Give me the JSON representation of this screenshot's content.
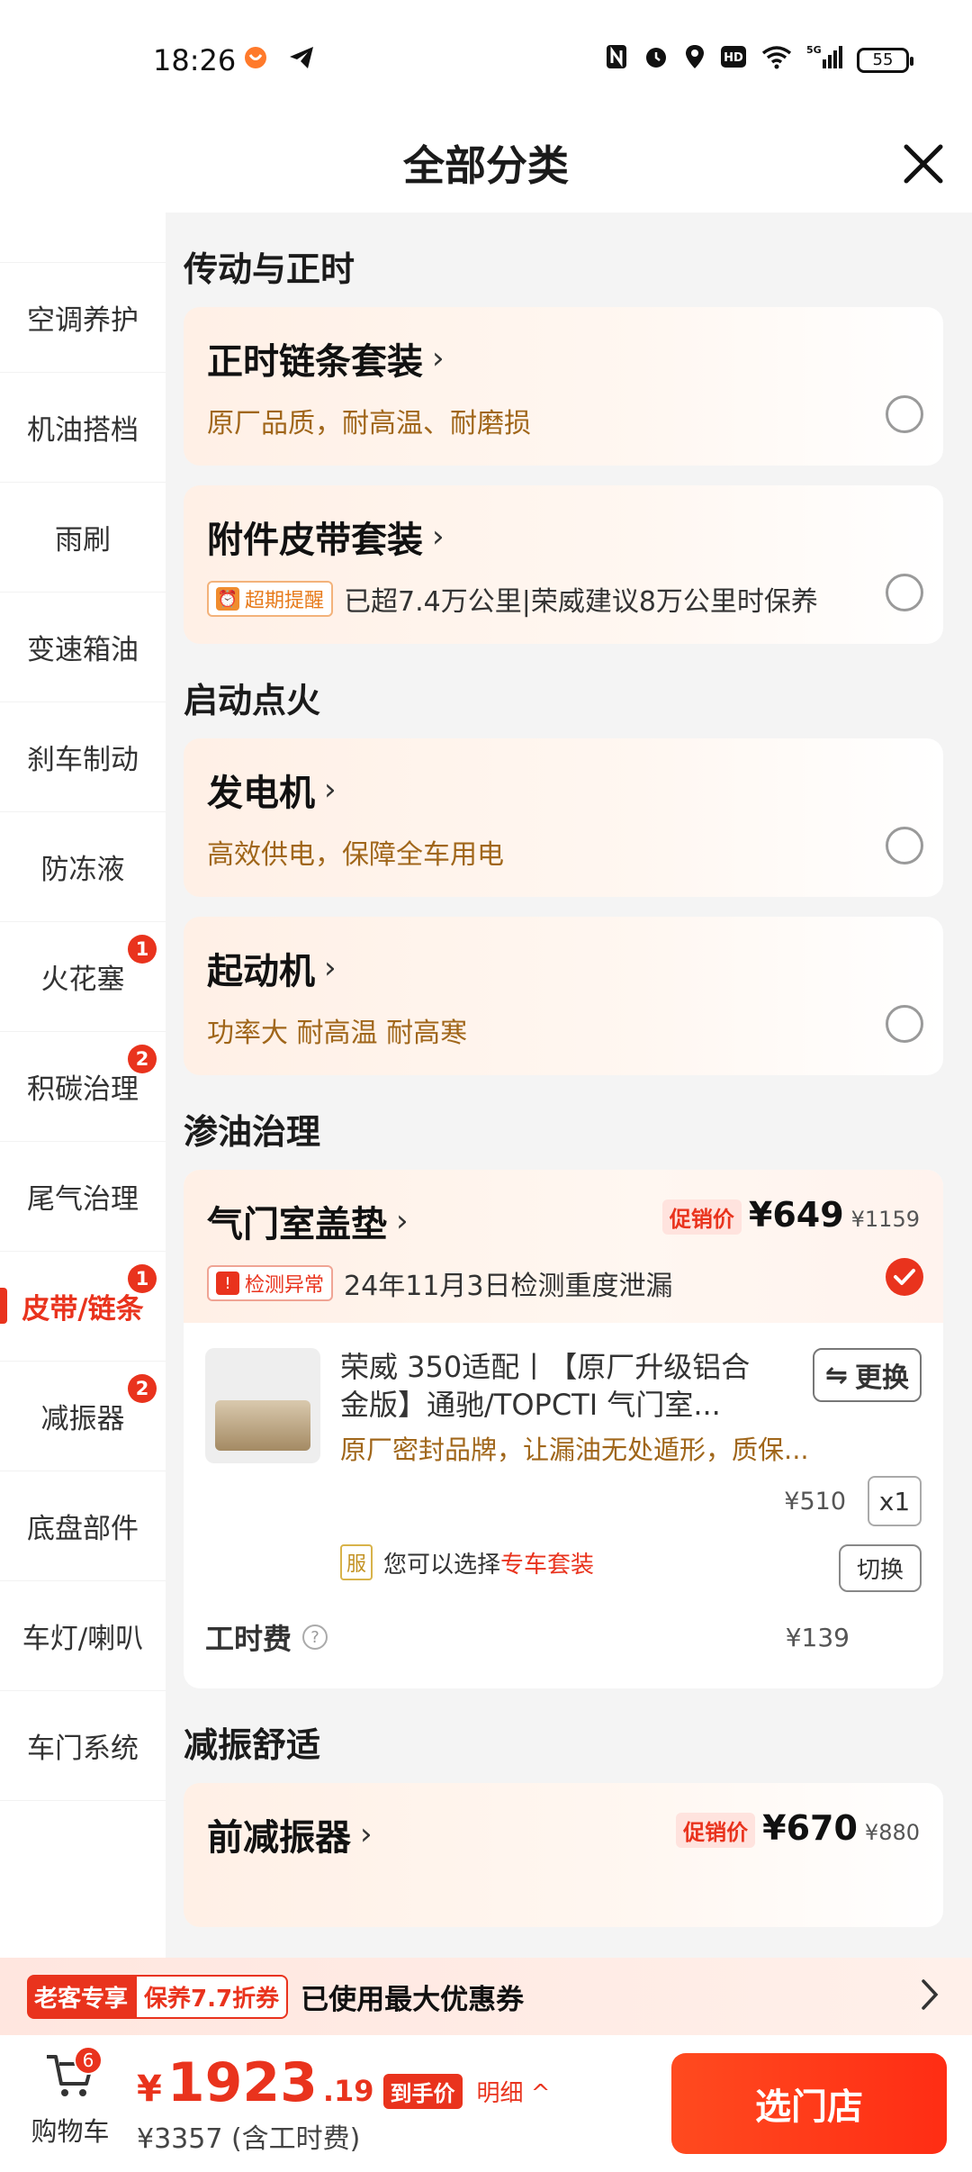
{
  "status_bar": {
    "time": "18:26",
    "battery": "55",
    "network": "5G"
  },
  "header": {
    "title": "全部分类"
  },
  "sidebar": {
    "items": [
      {
        "label": "空调养护",
        "badge": ""
      },
      {
        "label": "机油搭档",
        "badge": ""
      },
      {
        "label": "雨刷",
        "badge": ""
      },
      {
        "label": "变速箱油",
        "badge": ""
      },
      {
        "label": "刹车制动",
        "badge": ""
      },
      {
        "label": "防冻液",
        "badge": ""
      },
      {
        "label": "火花塞",
        "badge": "1"
      },
      {
        "label": "积碳治理",
        "badge": "2"
      },
      {
        "label": "尾气治理",
        "badge": ""
      },
      {
        "label": "皮带/链条",
        "badge": "1",
        "active": true
      },
      {
        "label": "减振器",
        "badge": "2"
      },
      {
        "label": "底盘部件",
        "badge": ""
      },
      {
        "label": "车灯/喇叭",
        "badge": ""
      },
      {
        "label": "车门系统",
        "badge": ""
      }
    ]
  },
  "sections": {
    "s1": {
      "title": "传动与正时",
      "c1": {
        "title": "正时链条套装",
        "desc": "原厂品质，耐高温、耐磨损"
      },
      "c2": {
        "title": "附件皮带套装",
        "tag": "超期提醒",
        "desc": "已超7.4万公里|荣威建议8万公里时保养"
      }
    },
    "s2": {
      "title": "启动点火",
      "c1": {
        "title": "发电机",
        "desc": "高效供电，保障全车用电"
      },
      "c2": {
        "title": "起动机",
        "desc": "功率大 耐高温 耐高寒"
      }
    },
    "s3": {
      "title": "渗油治理",
      "c1": {
        "title": "气门室盖垫",
        "promo": "促销价",
        "price": "¥649",
        "orig_price": "¥1159",
        "tag": "检测异常",
        "desc": "24年11月3日检测重度泄漏",
        "product": {
          "name": "荣威 350适配丨【原厂升级铝合金版】通驰/TOPCTI 气门室...",
          "sub": "原厂密封品牌，让漏油无处遁形，质保...",
          "swap": "更换",
          "unit_price": "¥510",
          "qty": "x1"
        },
        "service": {
          "icon": "服",
          "text": "您可以选择",
          "link": "专车套装",
          "switch": "切换"
        },
        "labor": {
          "label": "工时费",
          "price": "¥139"
        }
      }
    },
    "s4": {
      "title": "减振舒适",
      "c1": {
        "title": "前减振器",
        "promo": "促销价",
        "price": "¥670",
        "orig_price": "¥880"
      }
    }
  },
  "promo_bar": {
    "tag1": "老客专享",
    "tag2": "保养7.7折券",
    "text": "已使用最大优惠券"
  },
  "bottom_bar": {
    "cart_label": "购物车",
    "cart_count": "6",
    "yen": "¥",
    "total_int": "1923",
    "total_dec": ".19",
    "total_tag": "到手价",
    "detail": "明细 ^",
    "subtotal": "¥3357 (含工时费)",
    "cta": "选门店"
  },
  "colors": {
    "accent": "#e9331d",
    "desc_gold": "#a0661a"
  }
}
